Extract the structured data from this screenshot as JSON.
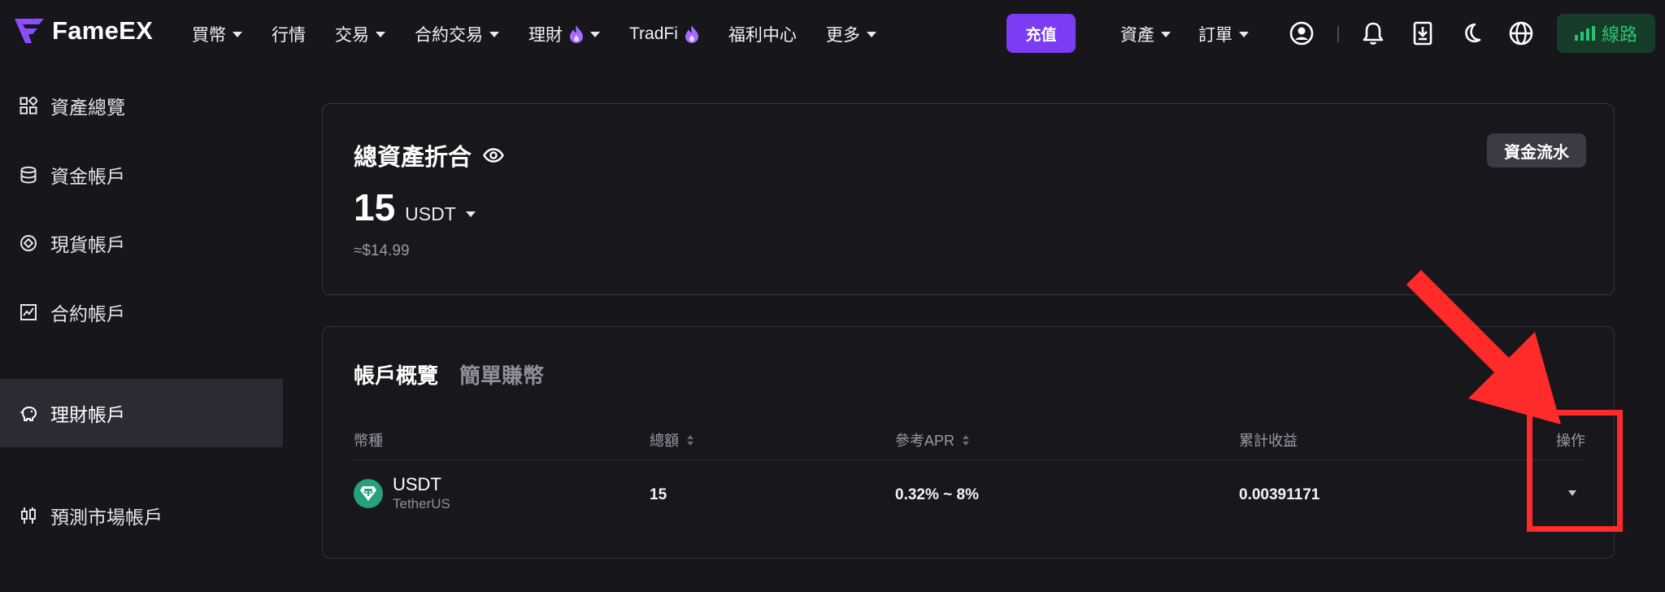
{
  "header": {
    "logo_text": "FameEX",
    "nav": [
      {
        "label": "買幣",
        "dropdown": true
      },
      {
        "label": "行情"
      },
      {
        "label": "交易",
        "dropdown": true
      },
      {
        "label": "合約交易",
        "dropdown": true
      },
      {
        "label": "理財",
        "hot": true,
        "dropdown": true
      },
      {
        "label": "TradFi",
        "hot": true
      },
      {
        "label": "福利中心"
      },
      {
        "label": "更多",
        "dropdown": true
      }
    ],
    "deposit_label": "充值",
    "right_nav": [
      {
        "label": "資產",
        "dropdown": true
      },
      {
        "label": "訂單",
        "dropdown": true
      }
    ],
    "icons": [
      "user-icon",
      "bell-icon",
      "download-icon",
      "moon-icon",
      "globe-icon"
    ],
    "line_label": "線路"
  },
  "sidebar": {
    "items": [
      {
        "label": "資產總覽",
        "icon": "grid-icon"
      },
      {
        "label": "資金帳戶",
        "icon": "database-icon"
      },
      {
        "label": "現貨帳戶",
        "icon": "spot-icon"
      },
      {
        "label": "合約帳戶",
        "icon": "chart-icon"
      },
      {
        "label": "理財帳戶",
        "icon": "piggy-icon",
        "active": true
      },
      {
        "label": "預測市場帳戶",
        "icon": "candles-icon"
      }
    ]
  },
  "summary": {
    "title": "總資產折合",
    "flow_button": "資金流水",
    "amount": "15",
    "unit": "USDT",
    "approx": "≈$14.99"
  },
  "overview": {
    "tabs": [
      "帳戶概覽",
      "簡單賺幣"
    ],
    "columns": [
      "幣種",
      "總額",
      "參考APR",
      "累計收益",
      "操作"
    ],
    "rows": [
      {
        "coin": "USDT",
        "coin_full": "TetherUS",
        "total": "15",
        "apr": "0.32% ~ 8%",
        "earnings": "0.00391171"
      }
    ]
  },
  "colors": {
    "accent": "#7b3cf3",
    "line_green": "#27c46e",
    "usdt": "#26a17b",
    "annotation": "#ff2b2b"
  }
}
